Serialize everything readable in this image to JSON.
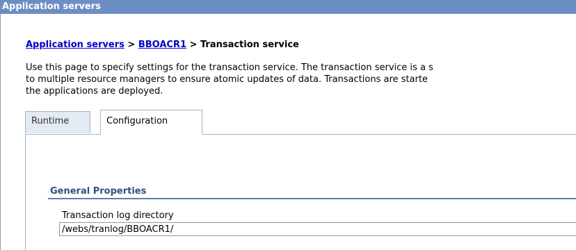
{
  "window": {
    "title": "Application servers"
  },
  "breadcrumb": {
    "link1": "Application servers",
    "sep1": " > ",
    "link2": "BBOACR1",
    "sep2": " > ",
    "current": "Transaction service"
  },
  "description": {
    "line1": "Use this page to specify settings for the transaction service. The transaction service is a s",
    "line2": "to multiple resource managers to ensure atomic updates of data. Transactions are starte",
    "line3": "the applications are deployed."
  },
  "tabs": [
    {
      "label": "Runtime",
      "active": false
    },
    {
      "label": "Configuration",
      "active": true
    }
  ],
  "general_properties": {
    "heading": "General Properties",
    "fields": [
      {
        "label": "Transaction log directory",
        "value": "/webs/tranlog/BBOACR1/"
      }
    ]
  },
  "colors": {
    "titlebar_bg": "#6d8ec4",
    "link": "#0000cc",
    "section_heading": "#2f4f83"
  }
}
